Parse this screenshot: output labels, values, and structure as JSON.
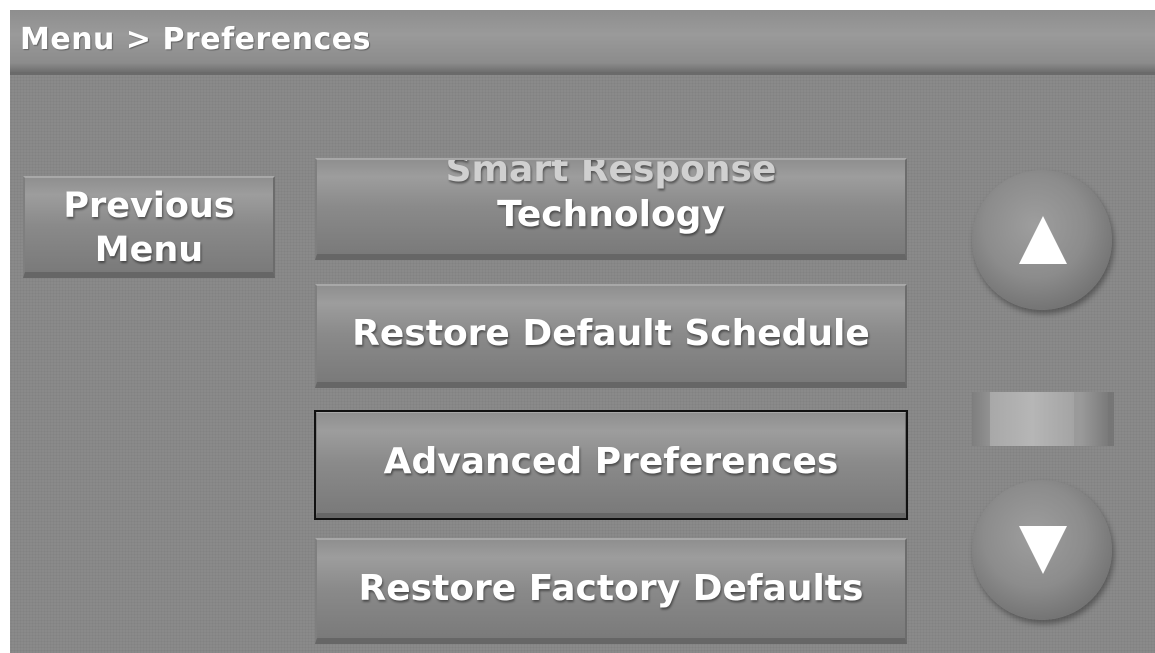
{
  "header": {
    "breadcrumb": "Menu > Preferences"
  },
  "nav": {
    "previous_line1": "Previous",
    "previous_line2": "Menu"
  },
  "menu": {
    "items": [
      {
        "label_line1": "Smart Response",
        "label_line2": "Technology"
      },
      {
        "label": "Restore Default Schedule"
      },
      {
        "label": "Advanced Preferences",
        "selected": true
      },
      {
        "label": "Restore Factory Defaults"
      }
    ]
  },
  "scroll": {
    "up_icon": "triangle-up-icon",
    "down_icon": "triangle-down-icon"
  },
  "colors": {
    "screen_bg": "#8a8a8a",
    "text": "#ffffff",
    "selected_outline": "#111111"
  }
}
